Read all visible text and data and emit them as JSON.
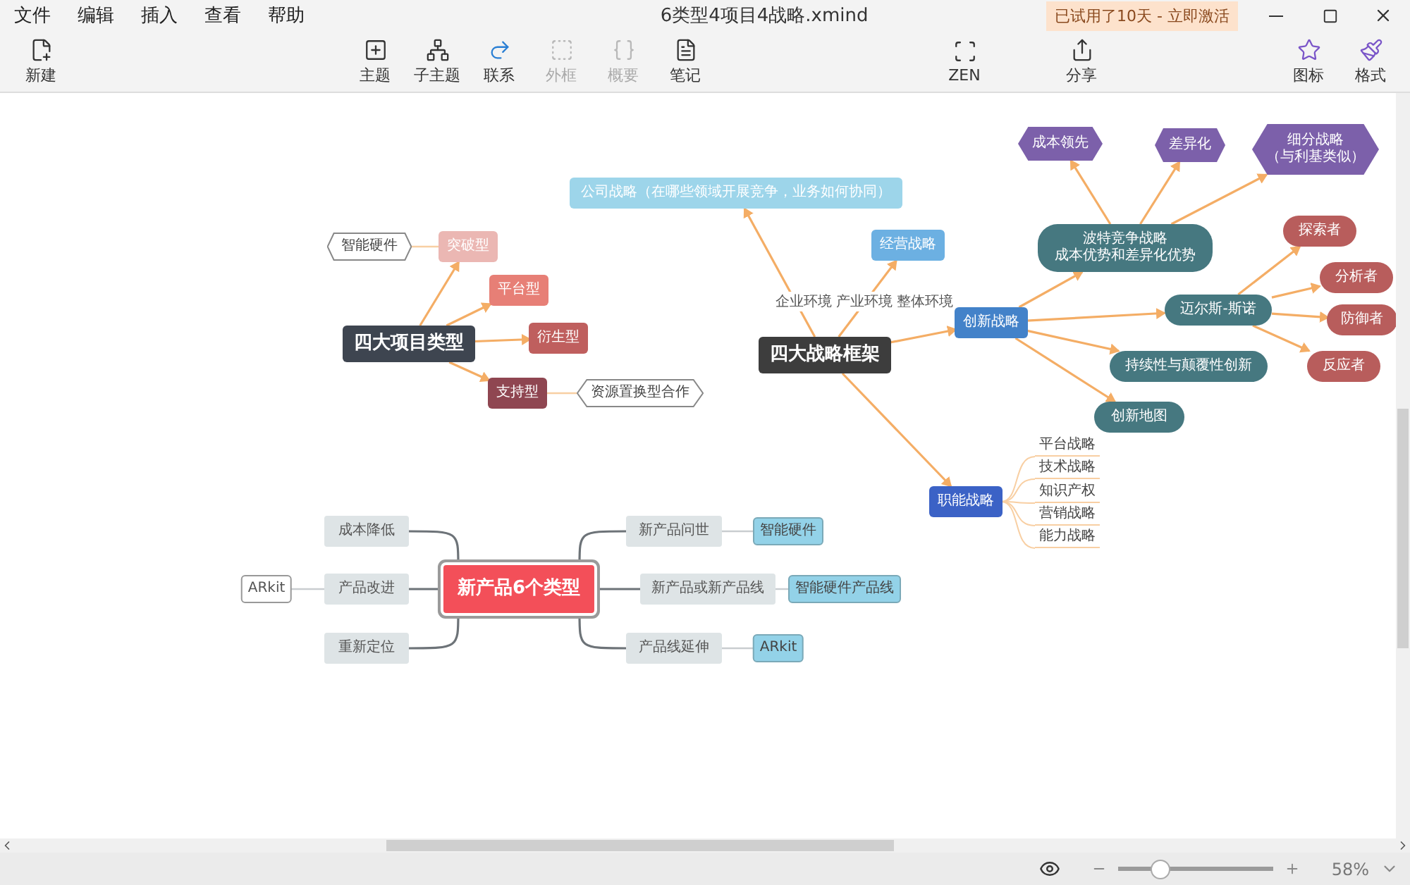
{
  "menu": [
    "文件",
    "编辑",
    "插入",
    "查看",
    "帮助"
  ],
  "window": {
    "title": "6类型4项目4战略.xmind",
    "trial_badge": "已试用了10天 - 立即激活"
  },
  "toolbar_groups": [
    {
      "items": [
        {
          "label": "新建",
          "disabled": false
        }
      ]
    },
    {
      "items": [
        {
          "label": "主题",
          "disabled": false
        },
        {
          "label": "子主题",
          "disabled": false
        },
        {
          "label": "联系",
          "disabled": false
        },
        {
          "label": "外框",
          "disabled": true
        },
        {
          "label": "概要",
          "disabled": true
        },
        {
          "label": "笔记",
          "disabled": false
        }
      ]
    },
    {
      "items": [
        {
          "label": "ZEN",
          "disabled": false
        }
      ]
    },
    {
      "items": [
        {
          "label": "分享",
          "disabled": false
        }
      ]
    },
    {
      "items": [
        {
          "label": "图标",
          "disabled": false
        },
        {
          "label": "格式",
          "disabled": false
        }
      ]
    }
  ],
  "maps": [
    {
      "kind": "arrow",
      "root": {
        "text": "四大项目类型",
        "kind": "root",
        "color": "#3e4550",
        "children": [
          {
            "text": "突破型",
            "kind": "box",
            "color": "#ebb7b3",
            "children": [
              {
                "text": "智能硬件",
                "kind": "outline-hexagon"
              }
            ]
          },
          {
            "text": "平台型",
            "kind": "box",
            "color": "#e77f76"
          },
          {
            "text": "衍生型",
            "kind": "box",
            "color": "#bf5f5e"
          },
          {
            "text": "支持型",
            "kind": "box",
            "color": "#8f4651",
            "children": [
              {
                "text": "资源置换型合作",
                "kind": "outline-hexagon"
              }
            ]
          }
        ]
      }
    },
    {
      "kind": "arrow",
      "label": "企业环境 产业环境 整体环境",
      "root": {
        "text": "四大战略框架",
        "kind": "root",
        "color": "#3d3d3d",
        "children": [
          {
            "text": "公司战略（在哪些领域开展竞争，业务如何协同）",
            "kind": "box",
            "color": "#9dd5ea"
          },
          {
            "text": "经营战略",
            "kind": "box",
            "color": "#6cb0e2"
          },
          {
            "text": "创新战略",
            "kind": "box",
            "color": "#4382c9",
            "children": [
              {
                "lines": [
                  "波特竞争战略",
                  "成本优势和差异化优势"
                ],
                "kind": "pill",
                "color": "#467880",
                "children": [
                  {
                    "text": "成本领先",
                    "kind": "hexagon",
                    "color": "#7c60aa"
                  },
                  {
                    "text": "差异化",
                    "kind": "hexagon",
                    "color": "#7c60aa"
                  },
                  {
                    "lines": [
                      "细分战略",
                      "（与利基类似）"
                    ],
                    "kind": "hexagon",
                    "color": "#7c60aa"
                  }
                ]
              },
              {
                "text": "迈尔斯-斯诺",
                "kind": "pill",
                "color": "#467880",
                "children": [
                  {
                    "text": "探索者",
                    "kind": "pill",
                    "color": "#b85d5c"
                  },
                  {
                    "text": "分析者",
                    "kind": "pill",
                    "color": "#b85d5c"
                  },
                  {
                    "text": "防御者",
                    "kind": "pill",
                    "color": "#b85d5c"
                  },
                  {
                    "text": "反应者",
                    "kind": "pill",
                    "color": "#b85d5c"
                  }
                ]
              },
              {
                "text": "持续性与颠覆性创新",
                "kind": "pill",
                "color": "#467880"
              },
              {
                "text": "创新地图",
                "kind": "pill",
                "color": "#467880"
              }
            ]
          },
          {
            "text": "职能战略",
            "kind": "box",
            "color": "#3b62c6",
            "children": [
              {
                "text": "平台战略",
                "kind": "line-item"
              },
              {
                "text": "技术战略",
                "kind": "line-item"
              },
              {
                "text": "知识产权",
                "kind": "line-item"
              },
              {
                "text": "营销战略",
                "kind": "line-item"
              },
              {
                "text": "能力战略",
                "kind": "line-item"
              }
            ]
          }
        ]
      }
    },
    {
      "kind": "curve",
      "root": {
        "text": "新产品6个类型",
        "kind": "center",
        "color": "#f34f59",
        "children": [
          {
            "text": "成本降低",
            "kind": "grey-box"
          },
          {
            "text": "产品改进",
            "kind": "grey-box",
            "children": [
              {
                "text": "ARkit",
                "kind": "outline-box"
              }
            ]
          },
          {
            "text": "重新定位",
            "kind": "grey-box"
          },
          {
            "text": "新产品问世",
            "kind": "grey-box",
            "children": [
              {
                "text": "智能硬件",
                "kind": "tag",
                "color": "#93d2e8"
              }
            ]
          },
          {
            "text": "新产品或新产品线",
            "kind": "grey-box",
            "children": [
              {
                "text": "智能硬件产品线",
                "kind": "tag",
                "color": "#93d2e8"
              }
            ]
          },
          {
            "text": "产品线延伸",
            "kind": "grey-box",
            "children": [
              {
                "text": "ARkit",
                "kind": "tag",
                "color": "#93d2e8"
              }
            ]
          }
        ]
      }
    }
  ],
  "zoom": {
    "level": 0.27,
    "reading": "58%"
  }
}
